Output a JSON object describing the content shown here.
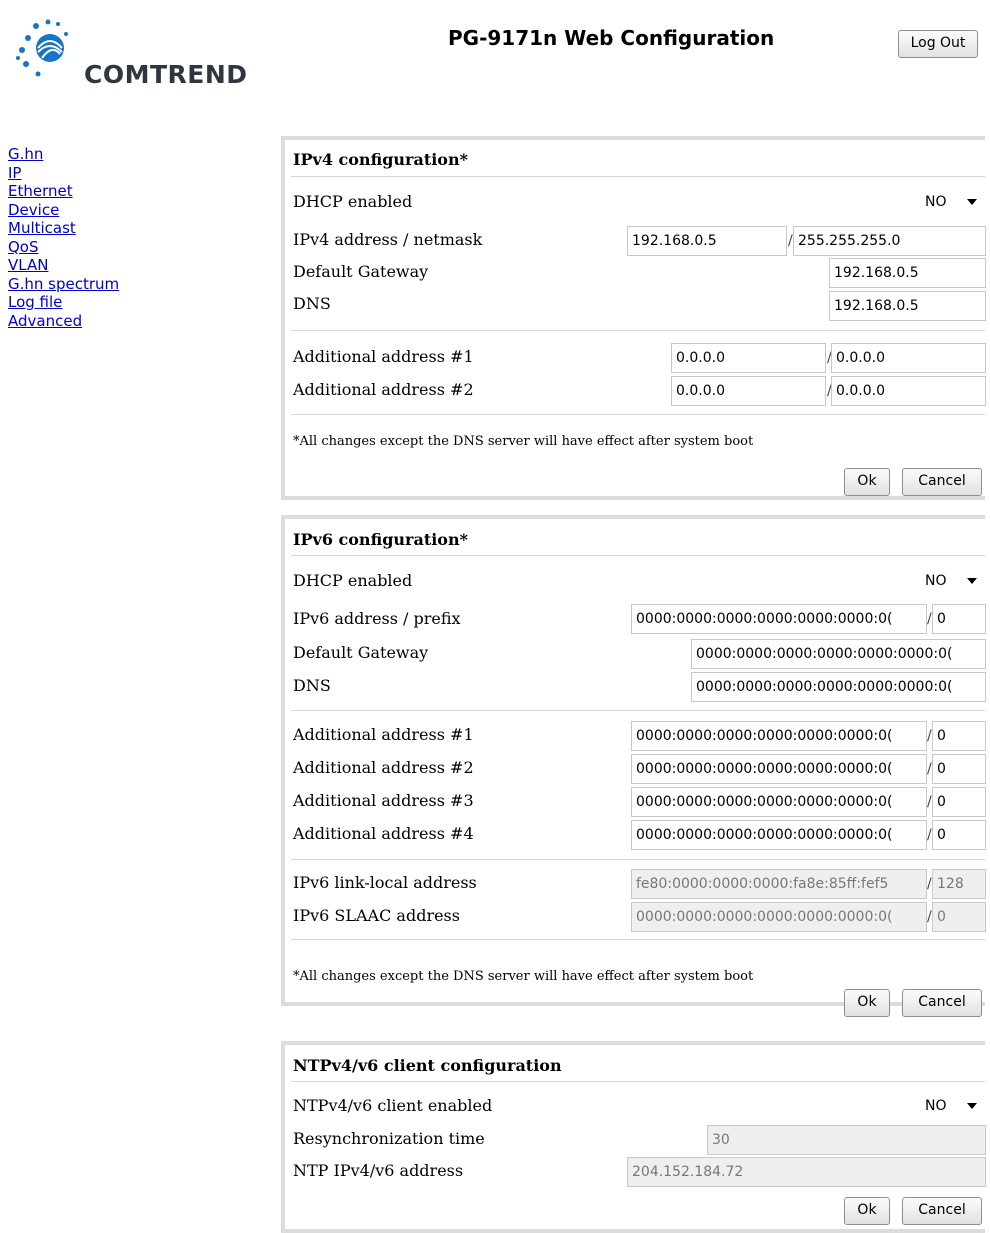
{
  "header": {
    "logo_text": "COMTREND",
    "title": "PG-9171n Web Configuration",
    "logout_label": "Log Out"
  },
  "sidebar": {
    "items": [
      {
        "label": "G.hn"
      },
      {
        "label": "IP"
      },
      {
        "label": "Ethernet"
      },
      {
        "label": "Device"
      },
      {
        "label": "Multicast"
      },
      {
        "label": "QoS"
      },
      {
        "label": "VLAN"
      },
      {
        "label": "G.hn spectrum"
      },
      {
        "label": "Log file"
      },
      {
        "label": "Advanced"
      }
    ]
  },
  "ipv4": {
    "title": "IPv4 configuration*",
    "dhcp_label": "DHCP enabled",
    "dhcp_value": "NO",
    "address_label": "IPv4 address / netmask",
    "address": "192.168.0.5",
    "netmask": "255.255.255.0",
    "gateway_label": "Default Gateway",
    "gateway": "192.168.0.5",
    "dns_label": "DNS",
    "dns": "192.168.0.5",
    "add1_label": "Additional address #1",
    "add1_addr": "0.0.0.0",
    "add1_mask": "0.0.0.0",
    "add2_label": "Additional address #2",
    "add2_addr": "0.0.0.0",
    "add2_mask": "0.0.0.0",
    "note": "*All changes except the DNS server will have effect after system boot",
    "ok_label": "Ok",
    "cancel_label": "Cancel"
  },
  "ipv6": {
    "title": "IPv6 configuration*",
    "dhcp_label": "DHCP enabled",
    "dhcp_value": "NO",
    "address_label": "IPv6 address / prefix",
    "address": "0000:0000:0000:0000:0000:0000:0(",
    "prefix": "0",
    "gateway_label": "Default Gateway",
    "gateway": "0000:0000:0000:0000:0000:0000:0(",
    "dns_label": "DNS",
    "dns": "0000:0000:0000:0000:0000:0000:0(",
    "add1_label": "Additional address #1",
    "add1_addr": "0000:0000:0000:0000:0000:0000:0(",
    "add1_prefix": "0",
    "add2_label": "Additional address #2",
    "add2_addr": "0000:0000:0000:0000:0000:0000:0(",
    "add2_prefix": "0",
    "add3_label": "Additional address #3",
    "add3_addr": "0000:0000:0000:0000:0000:0000:0(",
    "add3_prefix": "0",
    "add4_label": "Additional address #4",
    "add4_addr": "0000:0000:0000:0000:0000:0000:0(",
    "add4_prefix": "0",
    "linklocal_label": "IPv6 link-local address",
    "linklocal_addr": "fe80:0000:0000:0000:fa8e:85ff:fef5",
    "linklocal_prefix": "128",
    "slaac_label": "IPv6 SLAAC address",
    "slaac_addr": "0000:0000:0000:0000:0000:0000:0(",
    "slaac_prefix": "0",
    "note": "*All changes except the DNS server will have effect after system boot",
    "ok_label": "Ok",
    "cancel_label": "Cancel"
  },
  "ntp": {
    "title": "NTPv4/v6 client configuration",
    "enabled_label": "NTPv4/v6 client enabled",
    "enabled_value": "NO",
    "resync_label": "Resynchronization time",
    "resync_value": "30",
    "address_label": "NTP IPv4/v6 address",
    "address_value": "204.152.184.72",
    "ok_label": "Ok",
    "cancel_label": "Cancel"
  }
}
